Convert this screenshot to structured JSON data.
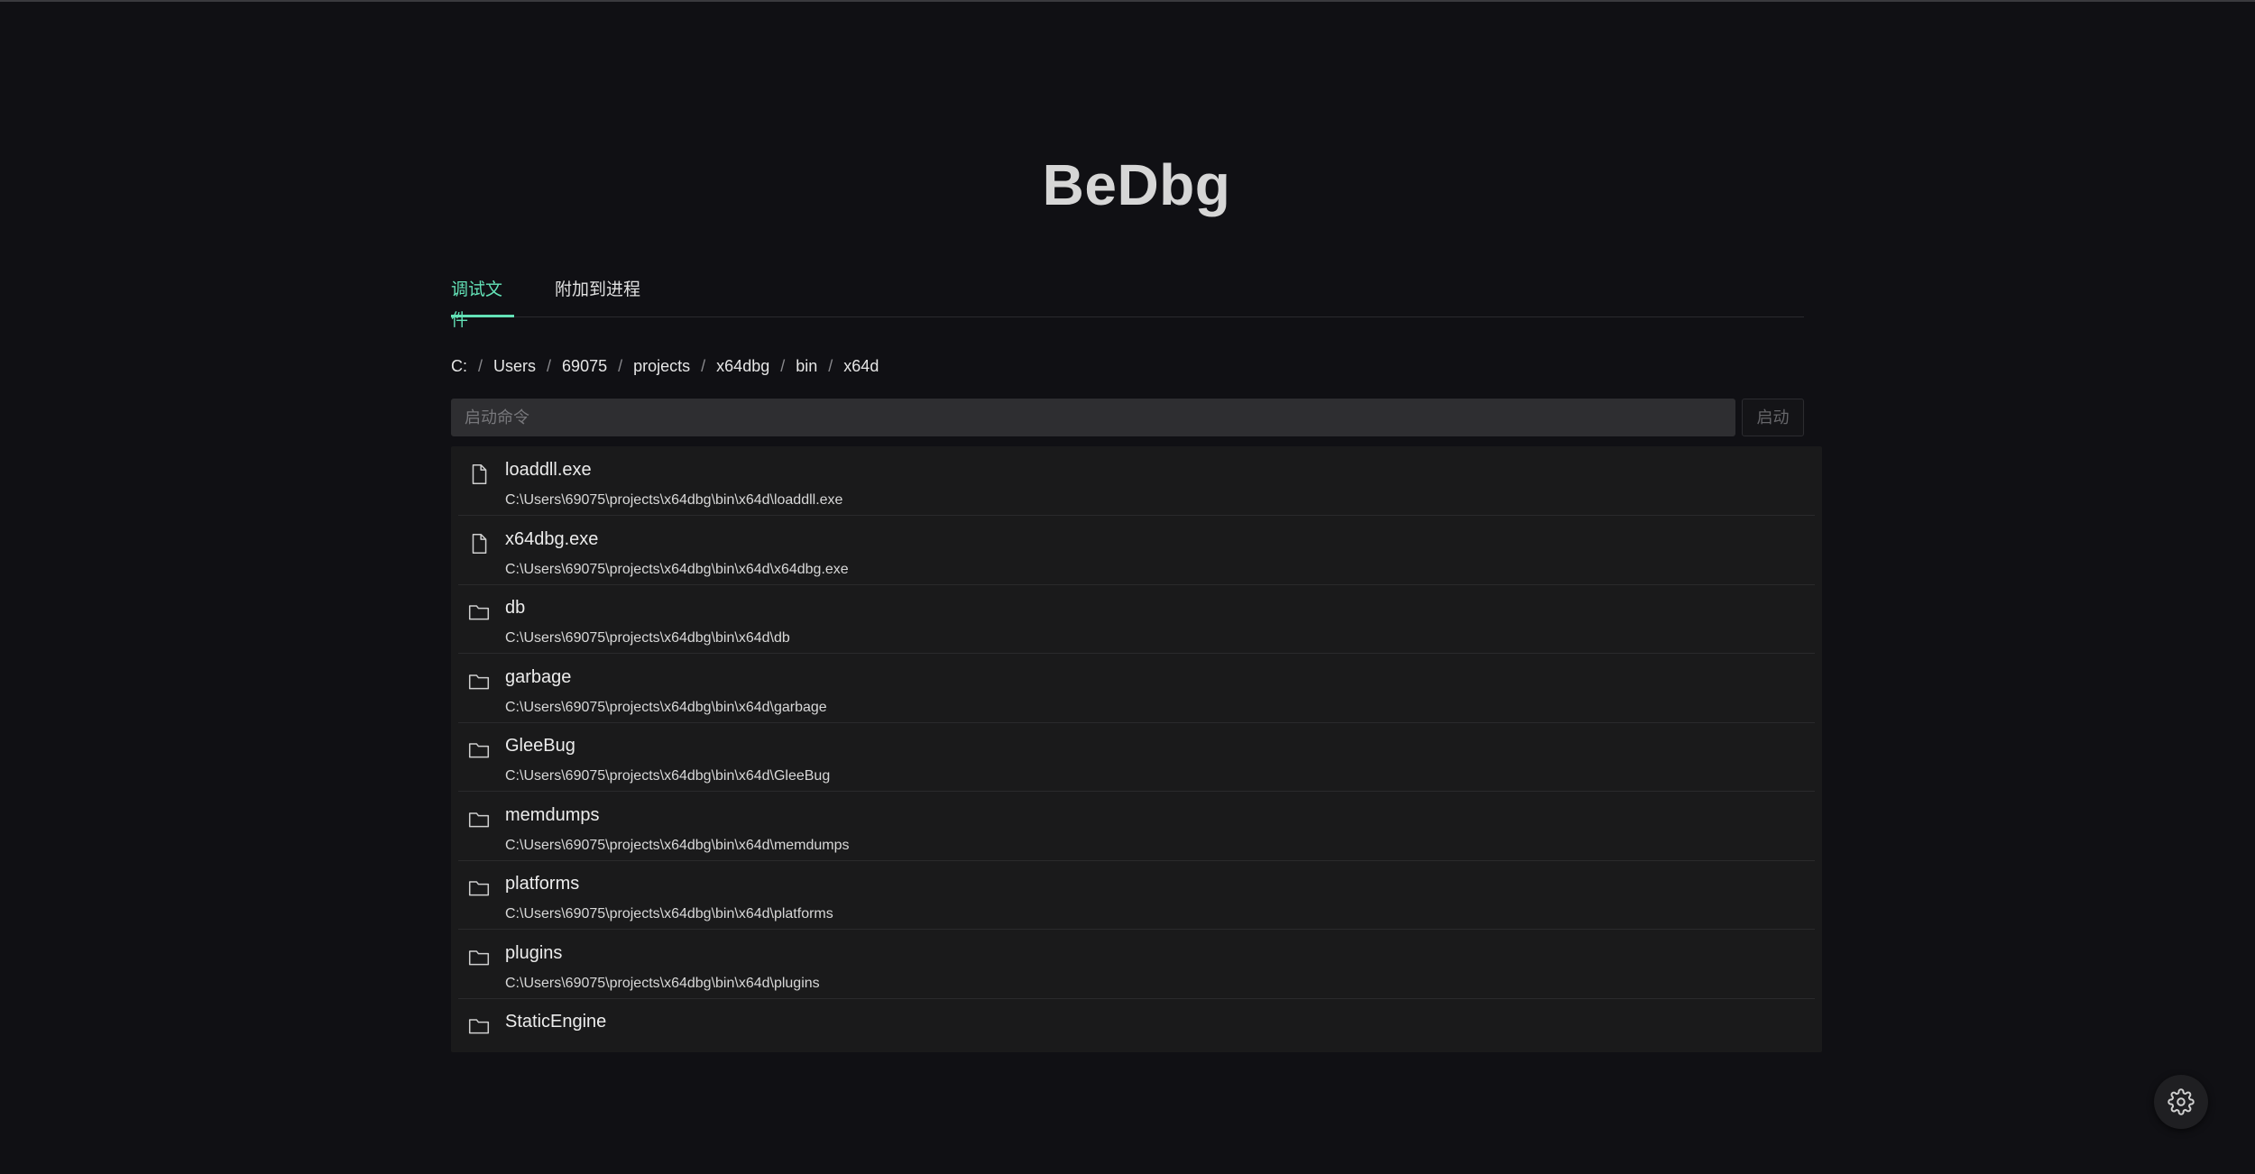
{
  "app": {
    "title": "BeDbg"
  },
  "tabs": [
    {
      "label": "调试文件",
      "active": true
    },
    {
      "label": "附加到进程",
      "active": false
    }
  ],
  "breadcrumb": [
    "C:",
    "Users",
    "69075",
    "projects",
    "x64dbg",
    "bin",
    "x64d"
  ],
  "command": {
    "placeholder": "启动命令",
    "value": "",
    "launch_label": "启动"
  },
  "files": [
    {
      "name": "loaddll.exe",
      "path": "C:\\Users\\69075\\projects\\x64dbg\\bin\\x64d\\loaddll.exe",
      "type": "file"
    },
    {
      "name": "x64dbg.exe",
      "path": "C:\\Users\\69075\\projects\\x64dbg\\bin\\x64d\\x64dbg.exe",
      "type": "file"
    },
    {
      "name": "db",
      "path": "C:\\Users\\69075\\projects\\x64dbg\\bin\\x64d\\db",
      "type": "folder"
    },
    {
      "name": "garbage",
      "path": "C:\\Users\\69075\\projects\\x64dbg\\bin\\x64d\\garbage",
      "type": "folder"
    },
    {
      "name": "GleeBug",
      "path": "C:\\Users\\69075\\projects\\x64dbg\\bin\\x64d\\GleeBug",
      "type": "folder"
    },
    {
      "name": "memdumps",
      "path": "C:\\Users\\69075\\projects\\x64dbg\\bin\\x64d\\memdumps",
      "type": "folder"
    },
    {
      "name": "platforms",
      "path": "C:\\Users\\69075\\projects\\x64dbg\\bin\\x64d\\platforms",
      "type": "folder"
    },
    {
      "name": "plugins",
      "path": "C:\\Users\\69075\\projects\\x64dbg\\bin\\x64d\\plugins",
      "type": "folder"
    },
    {
      "name": "StaticEngine",
      "path": "",
      "type": "folder"
    }
  ],
  "icons": {
    "file": "file-icon",
    "folder": "folder-icon",
    "settings": "gear-icon"
  },
  "colors": {
    "accent": "#63e2b7",
    "background": "#101014",
    "panel": "#1a1a1b"
  }
}
